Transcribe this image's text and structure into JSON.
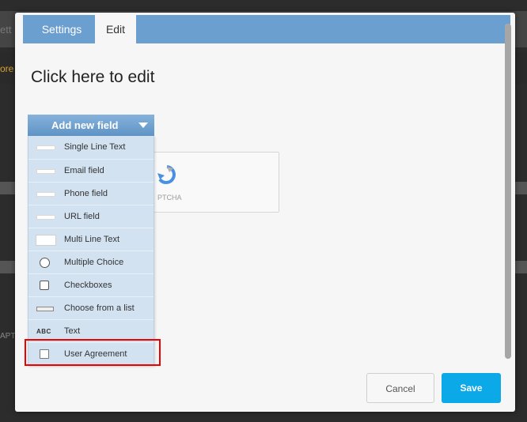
{
  "background": {
    "header_fragment": "ett",
    "nav_fragment": "ore",
    "captcha_fragment": "APTC"
  },
  "tabs": [
    {
      "label": "Settings",
      "active": false
    },
    {
      "label": "Edit",
      "active": true
    }
  ],
  "form": {
    "title": "Click here to edit"
  },
  "captcha": {
    "label": "PTCHA"
  },
  "dropdown": {
    "header": "Add new field",
    "items": [
      {
        "label": "Single Line Text",
        "icon": "single-line-icon"
      },
      {
        "label": "Email field",
        "icon": "email-field-icon"
      },
      {
        "label": "Phone field",
        "icon": "phone-field-icon"
      },
      {
        "label": "URL field",
        "icon": "url-field-icon"
      },
      {
        "label": "Multi Line Text",
        "icon": "multi-line-icon"
      },
      {
        "label": "Multiple Choice",
        "icon": "radio-icon"
      },
      {
        "label": "Checkboxes",
        "icon": "checkbox-icon"
      },
      {
        "label": "Choose from a list",
        "icon": "select-icon"
      },
      {
        "label": "Text",
        "icon": "text-icon",
        "icon_text": "ABC"
      },
      {
        "label": "User Agreement",
        "icon": "agreement-icon",
        "highlighted": true
      }
    ]
  },
  "buttons": {
    "cancel": "Cancel",
    "save": "Save"
  },
  "colors": {
    "tabbar": "#6b9fcf",
    "save_button": "#0ba9e8",
    "highlight": "#ee0000"
  }
}
